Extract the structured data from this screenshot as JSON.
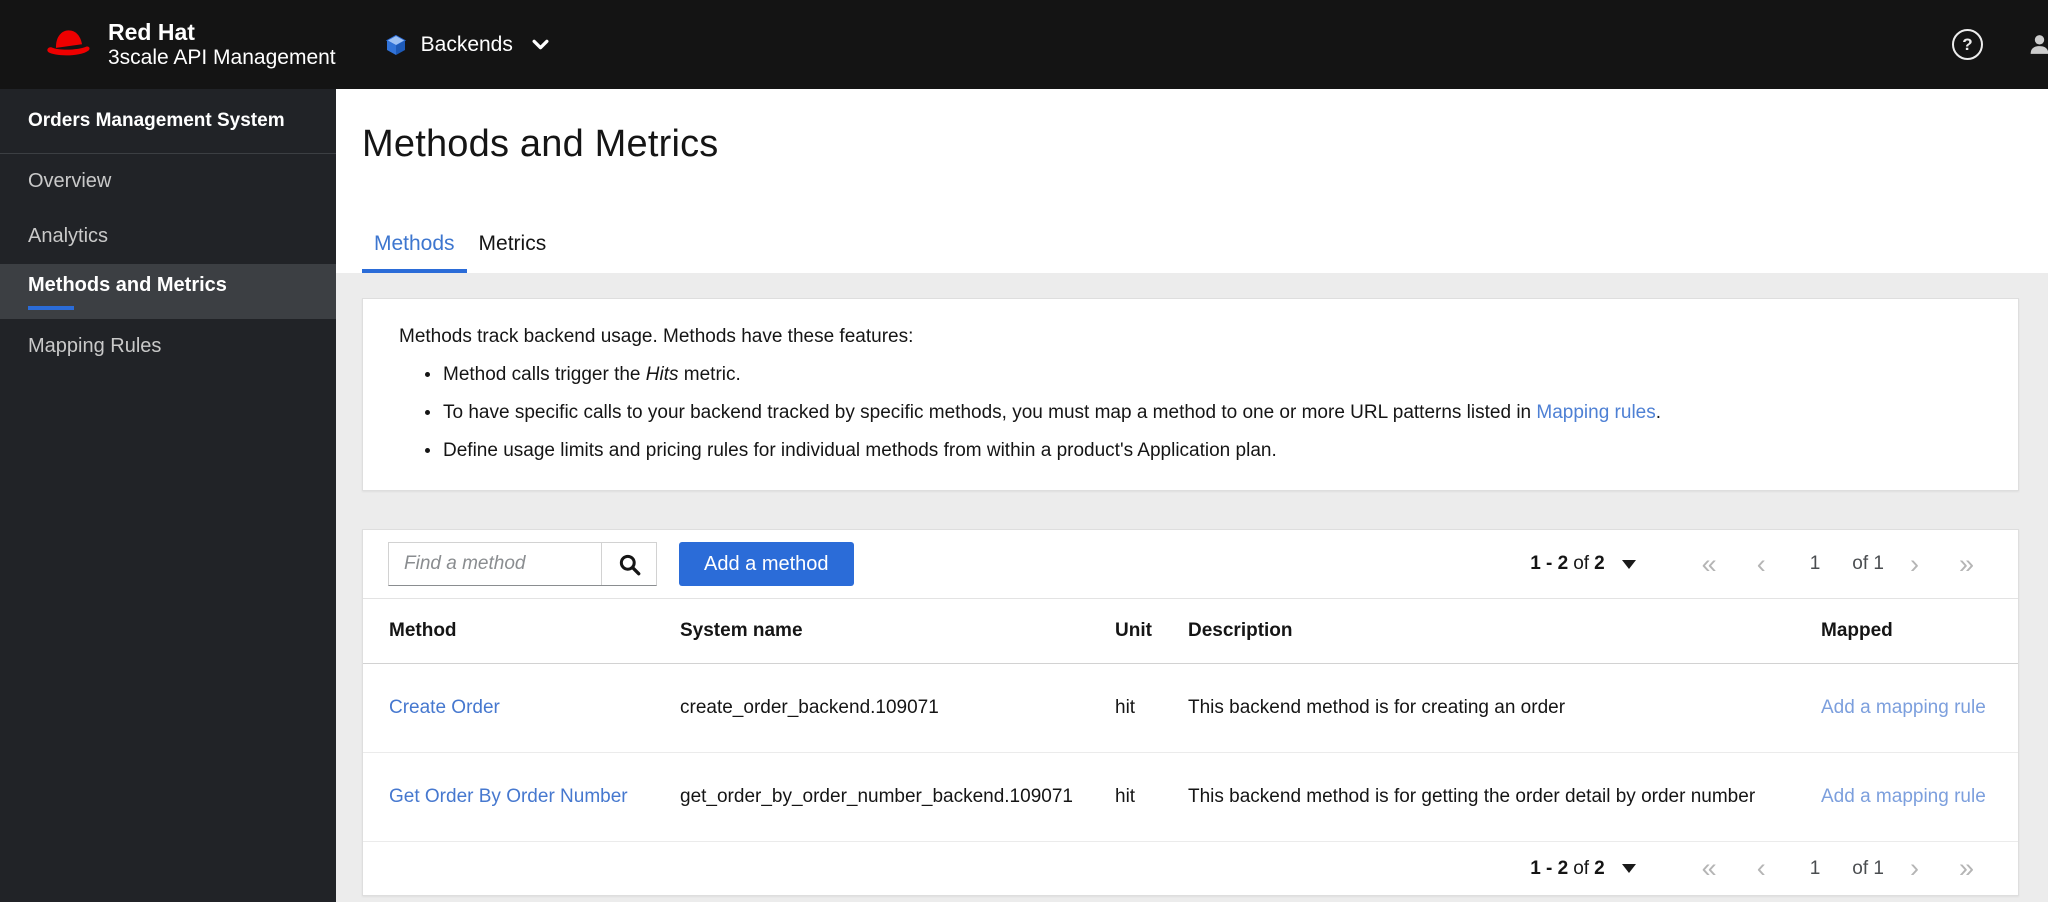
{
  "colors": {
    "brand_red": "#ee0000",
    "accent_blue": "#2b6cd8",
    "masthead_bg": "#141414",
    "sidebar_bg": "#212327",
    "link_blue": "#4678cf",
    "light_link_blue": "#7c9fdd",
    "content_bg": "#ececec"
  },
  "masthead": {
    "brand_line1": "Red Hat",
    "brand_line2": "3scale API Management",
    "context_selector_label": "Backends",
    "help_glyph": "?"
  },
  "sidebar": {
    "section_title": "Orders Management System",
    "items": [
      {
        "label": "Overview",
        "active": false
      },
      {
        "label": "Analytics",
        "active": false
      },
      {
        "label": "Methods and Metrics",
        "active": true
      },
      {
        "label": "Mapping Rules",
        "active": false
      }
    ]
  },
  "main": {
    "title": "Methods and Metrics",
    "tabs": [
      {
        "label": "Methods",
        "active": true
      },
      {
        "label": "Metrics",
        "active": false
      }
    ],
    "info": {
      "intro": "Methods track backend usage. Methods have these features:",
      "bullets": [
        {
          "pre": "Method calls trigger the ",
          "em": "Hits",
          "post": " metric."
        },
        {
          "pre": "To have specific calls to your backend tracked by specific methods, you must map a method to one or more URL patterns listed in ",
          "link": "Mapping rules",
          "post": "."
        },
        {
          "text": "Define usage limits and pricing rules for individual methods from within a product's Application plan."
        }
      ]
    },
    "toolbar": {
      "search_placeholder": "Find a method",
      "add_button": "Add a method"
    },
    "pagination": {
      "range": "1 - 2",
      "of_word": "of",
      "total": "2",
      "first_icon": "«",
      "prev_icon": "‹",
      "page": "1",
      "of_pages": "of 1",
      "next_icon": "›",
      "last_icon": "»"
    },
    "table": {
      "columns": [
        "Method",
        "System name",
        "Unit",
        "Description",
        "Mapped"
      ],
      "rows": [
        {
          "method": "Create Order",
          "system_name": "create_order_backend.109071",
          "unit": "hit",
          "description": "This backend method is for creating an order",
          "mapped": "Add a mapping rule"
        },
        {
          "method": "Get Order By Order Number",
          "system_name": "get_order_by_order_number_backend.109071",
          "unit": "hit",
          "description": "This backend method is for getting the order detail by order number",
          "mapped": "Add a mapping rule"
        }
      ]
    }
  }
}
